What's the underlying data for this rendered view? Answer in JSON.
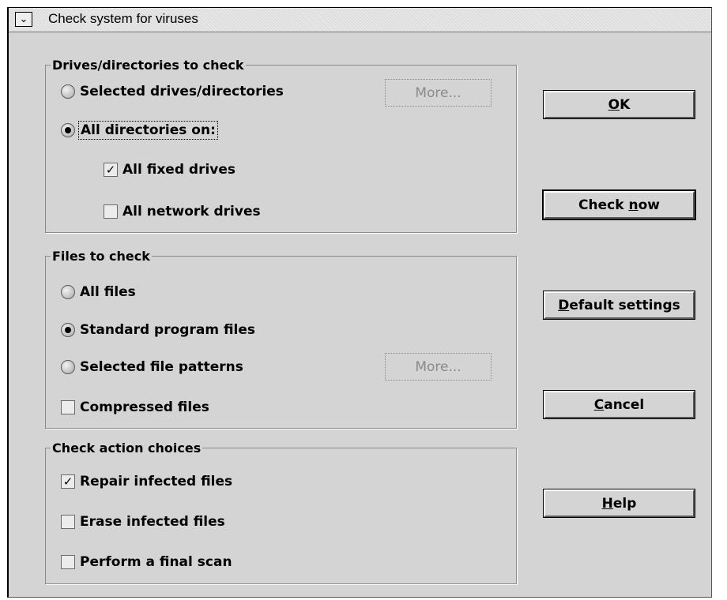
{
  "window": {
    "title": "Check system for viruses",
    "sysmenu_glyph": "⌄"
  },
  "drives_group": {
    "legend": "Drives/directories to check",
    "selected_label": "Selected drives/directories",
    "more_label": "More...",
    "all_dirs_label": "All directories on:",
    "fixed_label": "All fixed drives",
    "network_label": "All network drives",
    "scope": "all",
    "fixed_checked": true,
    "network_checked": false
  },
  "files_group": {
    "legend": "Files to check",
    "all_label": "All files",
    "standard_label": "Standard program files",
    "patterns_label": "Selected file patterns",
    "more_label": "More...",
    "compressed_label": "Compressed files",
    "selected": "standard",
    "compressed_checked": false
  },
  "action_group": {
    "legend": "Check action choices",
    "repair_label": "Repair infected files",
    "erase_label": "Erase infected files",
    "final_scan_label": "Perform a final scan",
    "repair_checked": true,
    "erase_checked": false,
    "final_scan_checked": false
  },
  "buttons": {
    "ok": {
      "pre": "",
      "key": "O",
      "post": "K"
    },
    "check_now": {
      "pre": "Check ",
      "key": "n",
      "post": "ow"
    },
    "default_settings": {
      "pre": "",
      "key": "D",
      "post": "efault settings"
    },
    "cancel": {
      "pre": "",
      "key": "C",
      "post": "ancel"
    },
    "help": {
      "pre": "",
      "key": "H",
      "post": "elp"
    }
  },
  "check_glyph": "✓"
}
